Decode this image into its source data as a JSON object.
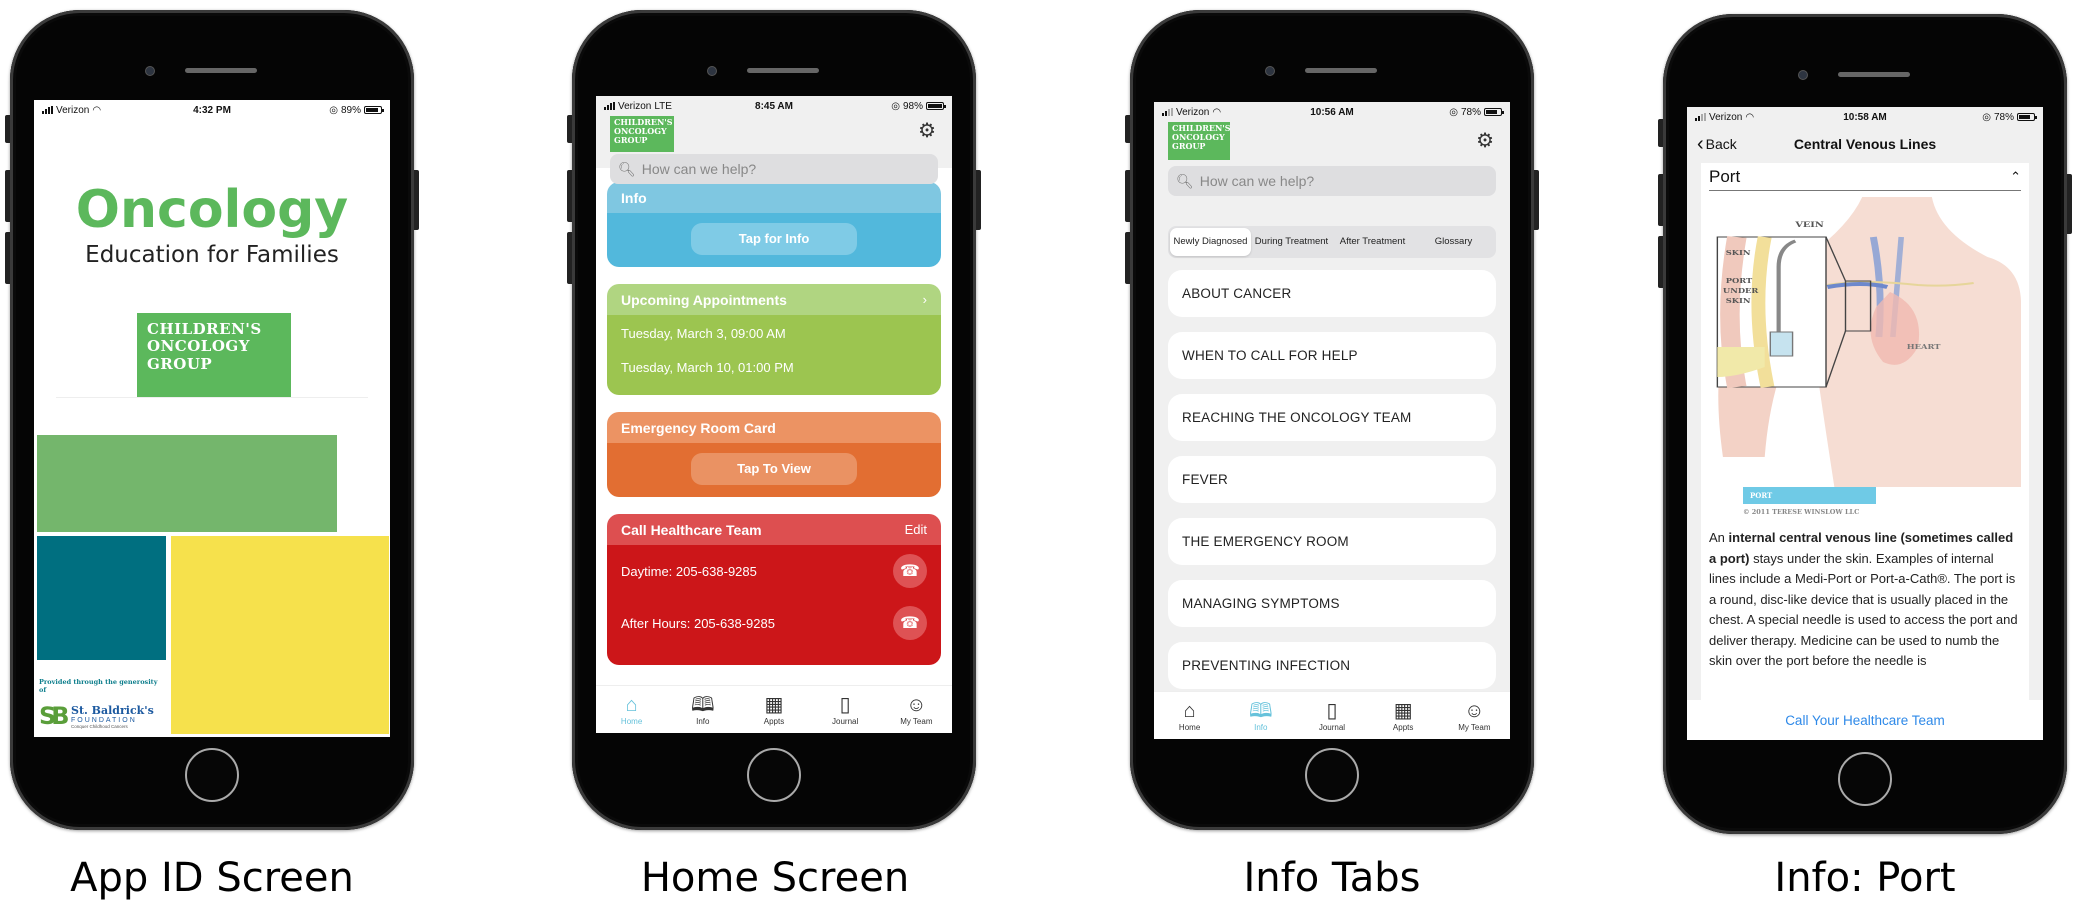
{
  "captions": [
    "App ID Screen",
    "Home Screen",
    "Info Tabs",
    "Info: Port"
  ],
  "colors": {
    "cog_green": "#5cb85c",
    "info_blue": "#52b8dc",
    "appt_green": "#9cc550",
    "er_orange": "#e26e32",
    "call_red": "#cc1619",
    "tab_active": "#66c2db",
    "link_blue": "#2e89e8",
    "block_green": "#74b66c",
    "block_teal": "#006f80",
    "block_yellow": "#f6e14c"
  },
  "phone1": {
    "status": {
      "carrier": "Verizon",
      "network": "wifi",
      "time": "4:32 PM",
      "battery": "89%",
      "battery_level": 0.89
    },
    "title": "Oncology",
    "subtitle": "Education for Families",
    "logo_lines": [
      "CHILDREN'S",
      "ONCOLOGY",
      "GROUP"
    ],
    "provided_by": "Provided through the generosity of",
    "sponsor": {
      "mark": "SB",
      "name": "St. Baldrick's",
      "line2": "FOUNDATION",
      "tagline": "Conquer Childhood Cancers"
    }
  },
  "phone2": {
    "status": {
      "carrier": "Verizon",
      "network": "LTE",
      "time": "8:45 AM",
      "battery": "98%",
      "battery_level": 0.98
    },
    "logo_lines": [
      "CHILDREN'S",
      "ONCOLOGY",
      "GROUP"
    ],
    "search_placeholder": "How can we help?",
    "cards": {
      "info": {
        "title": "Info",
        "button": "Tap for Info"
      },
      "appointments": {
        "title": "Upcoming Appointments",
        "items": [
          "Tuesday, March 3, 09:00 AM",
          "Tuesday, March 10, 01:00 PM"
        ]
      },
      "er": {
        "title": "Emergency Room Card",
        "button": "Tap To View"
      },
      "call": {
        "title": "Call Healthcare Team",
        "edit": "Edit",
        "rows": [
          "Daytime: 205-638-9285",
          "After Hours: 205-638-9285"
        ]
      }
    },
    "tabs": [
      {
        "label": "Home",
        "icon": "home-icon",
        "active": true
      },
      {
        "label": "Info",
        "icon": "book-icon",
        "active": false
      },
      {
        "label": "Appts",
        "icon": "calendar-icon",
        "active": false
      },
      {
        "label": "Journal",
        "icon": "journal-icon",
        "active": false
      },
      {
        "label": "My Team",
        "icon": "team-icon",
        "active": false
      }
    ]
  },
  "phone3": {
    "status": {
      "carrier": "Verizon",
      "network": "wifi",
      "time": "10:56 AM",
      "battery": "78%",
      "battery_level": 0.78
    },
    "logo_lines": [
      "CHILDREN'S",
      "ONCOLOGY",
      "GROUP"
    ],
    "search_placeholder": "How can we help?",
    "segments": [
      {
        "label": "Newly Diagnosed",
        "active": true
      },
      {
        "label": "During Treatment",
        "active": false
      },
      {
        "label": "After Treatment",
        "active": false
      },
      {
        "label": "Glossary",
        "active": false
      }
    ],
    "topics": [
      "ABOUT CANCER",
      "WHEN TO CALL FOR HELP",
      "REACHING THE ONCOLOGY TEAM",
      "FEVER",
      "THE EMERGENCY ROOM",
      "MANAGING SYMPTOMS",
      "PREVENTING INFECTION"
    ],
    "tabs": [
      {
        "label": "Home",
        "icon": "home-icon",
        "active": false
      },
      {
        "label": "Info",
        "icon": "book-icon",
        "active": true
      },
      {
        "label": "Journal",
        "icon": "journal-icon",
        "active": false
      },
      {
        "label": "Appts",
        "icon": "calendar-icon",
        "active": false
      },
      {
        "label": "My Team",
        "icon": "team-icon",
        "active": false
      }
    ]
  },
  "phone4": {
    "status": {
      "carrier": "Verizon",
      "network": "wifi",
      "time": "10:58 AM",
      "battery": "78%",
      "battery_level": 0.78
    },
    "back_label": "Back",
    "nav_title": "Central Venous Lines",
    "section_title": "Port",
    "illustration_labels": {
      "vein": "VEIN",
      "skin": "SKIN",
      "port_under_skin": "PORT UNDER SKIN",
      "heart": "HEART"
    },
    "caption_bar": "PORT",
    "copyright": "© 2011 TERESE WINSLOW LLC",
    "body_intro": "An ",
    "body_bold": "internal central venous line (sometimes called a port)",
    "body_rest": " stays under the skin. Examples of internal lines include a Medi-Port or Port-a-Cath®. The port is a round, disc-like device that is usually placed in the chest. A special needle is used to access the port and deliver therapy. Medicine can be used to numb the skin over the port before the needle is",
    "cta": "Call Your Healthcare Team"
  }
}
